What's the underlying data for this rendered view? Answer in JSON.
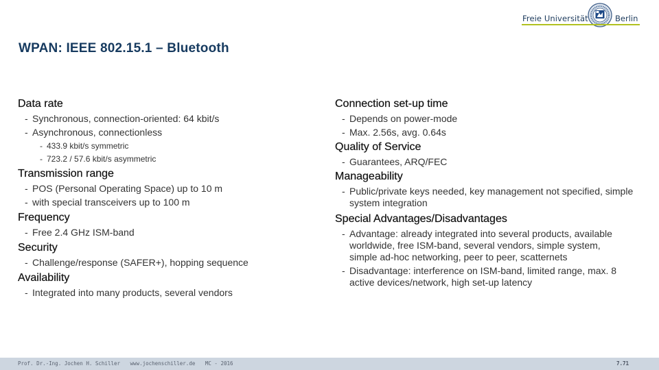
{
  "logo": {
    "text_left": "Freie Universität",
    "text_right": "Berlin",
    "seal_icon": "university-seal-icon",
    "underline_color": "#b1c11f"
  },
  "title": "WPAN: IEEE 802.15.1 – Bluetooth",
  "left_column": {
    "sections": [
      {
        "heading": "Data rate",
        "items": [
          "Synchronous, connection-oriented: 64 kbit/s",
          "Asynchronous, connectionless"
        ],
        "subitems": [
          "433.9 kbit/s symmetric",
          "723.2 / 57.6 kbit/s asymmetric"
        ]
      },
      {
        "heading": "Transmission range",
        "items": [
          "POS (Personal Operating Space) up to 10 m",
          "with special transceivers up to 100 m"
        ]
      },
      {
        "heading": "Frequency",
        "items": [
          "Free 2.4 GHz ISM-band"
        ]
      },
      {
        "heading": "Security",
        "items": [
          "Challenge/response (SAFER+), hopping sequence"
        ]
      },
      {
        "heading": "Availability",
        "items": [
          "Integrated into many products, several vendors"
        ]
      }
    ]
  },
  "right_column": {
    "sections": [
      {
        "heading": "Connection set-up time",
        "items": [
          "Depends on power-mode",
          "Max. 2.56s, avg. 0.64s"
        ]
      },
      {
        "heading": "Quality of Service",
        "items": [
          "Guarantees, ARQ/FEC"
        ]
      },
      {
        "heading": "Manageability",
        "items": [
          "Public/private keys needed, key management not specified, simple system integration"
        ]
      },
      {
        "heading": "Special Advantages/Disadvantages",
        "items": [
          "Advantage: already integrated into several products, available worldwide, free ISM-band, several vendors, simple system, simple ad-hoc networking, peer to peer, scatternets",
          "Disadvantage: interference on ISM-band, limited range, max. 8 active devices/network, high set-up latency"
        ]
      }
    ]
  },
  "footer": {
    "author": "Prof. Dr.-Ing. Jochen H. Schiller",
    "website": "www.jochenschiller.de",
    "course": "MC - 2016",
    "page_number": "7.71",
    "background_color": "#cdd6e0"
  },
  "bullet": "-"
}
